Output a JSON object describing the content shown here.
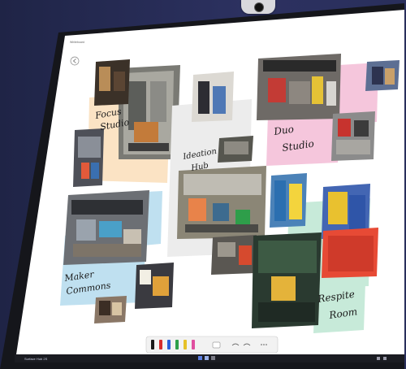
{
  "app": {
    "header_label": "Whiteboard"
  },
  "board": {
    "labels": {
      "focus": [
        "Focus",
        "Studio"
      ],
      "ideation": [
        "Ideation",
        "Hub"
      ],
      "duo": [
        "Duo",
        "Studio"
      ],
      "maker": [
        "Maker",
        "Commons"
      ],
      "respite": [
        "Respite",
        "Room"
      ]
    }
  },
  "taskbar": {
    "left_text": "Surface Hub 2S"
  },
  "icons": {
    "back": "back-circle-icon",
    "pens": [
      "pen-black-icon",
      "pen-red-icon",
      "pen-blue-icon",
      "pen-green-icon",
      "pen-yellow-icon",
      "pen-pink-icon"
    ],
    "eraser": "eraser-icon",
    "undo": "undo-icon",
    "redo": "redo-icon",
    "more": "more-icon"
  },
  "colors": {
    "frame": "#1b1c22",
    "canvas": "#ffffff",
    "focus_note": "#fbe3c4",
    "duo_note": "#f5c6dc",
    "maker_note": "#bfe0f0",
    "respite_note": "#c7ead9",
    "ideation_note": "#ececec"
  }
}
